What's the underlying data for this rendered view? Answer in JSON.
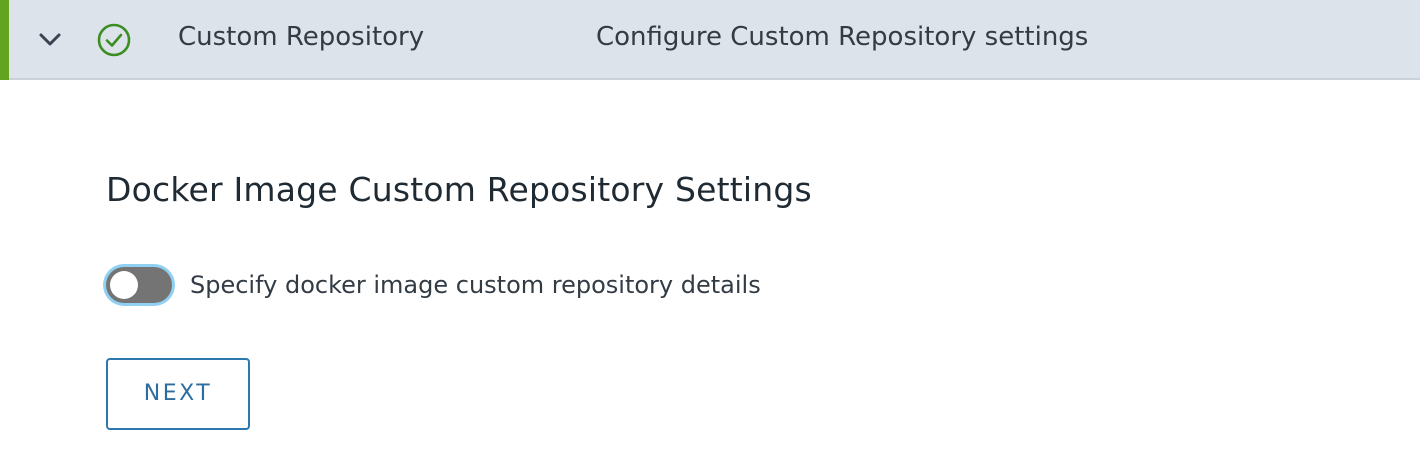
{
  "step": {
    "title": "Custom Repository",
    "description": "Configure Custom Repository settings",
    "status": "completed",
    "expanded": true,
    "accent_color": "#62a420",
    "check_color": "#3c8e23",
    "icons": {
      "expand": "chevron-down-icon",
      "status": "check-circle-icon"
    }
  },
  "section": {
    "title": "Docker Image Custom Repository Settings",
    "toggle": {
      "label": "Specify docker image custom repository details",
      "checked": false
    },
    "next_label": "NEXT"
  }
}
